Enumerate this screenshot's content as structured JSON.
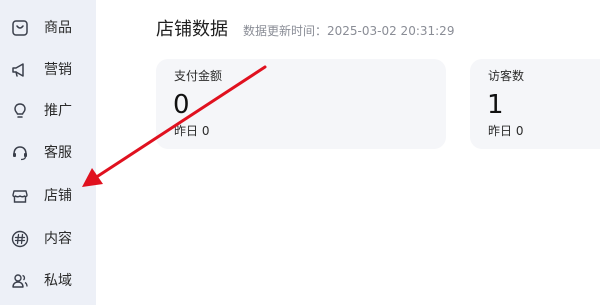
{
  "sidebar": {
    "items": [
      {
        "label": "商品",
        "icon": "product-icon"
      },
      {
        "label": "营销",
        "icon": "megaphone-icon"
      },
      {
        "label": "推广",
        "icon": "bulb-icon"
      },
      {
        "label": "客服",
        "icon": "headset-icon"
      },
      {
        "label": "店铺",
        "icon": "store-icon"
      },
      {
        "label": "内容",
        "icon": "hashtag-icon"
      },
      {
        "label": "私域",
        "icon": "users-icon"
      }
    ]
  },
  "main": {
    "title": "店铺数据",
    "update_time": "数据更新时间：2025-03-02 20:31:29",
    "cards": [
      {
        "label": "支付金额",
        "value": "0",
        "yesterday": "昨日 0"
      },
      {
        "label": "访客数",
        "value": "1",
        "yesterday": "昨日 0"
      }
    ]
  },
  "colors": {
    "sidebar_bg": "#edf0f7",
    "card_bg": "#f5f6f9",
    "annotation_arrow": "#e0111f"
  }
}
